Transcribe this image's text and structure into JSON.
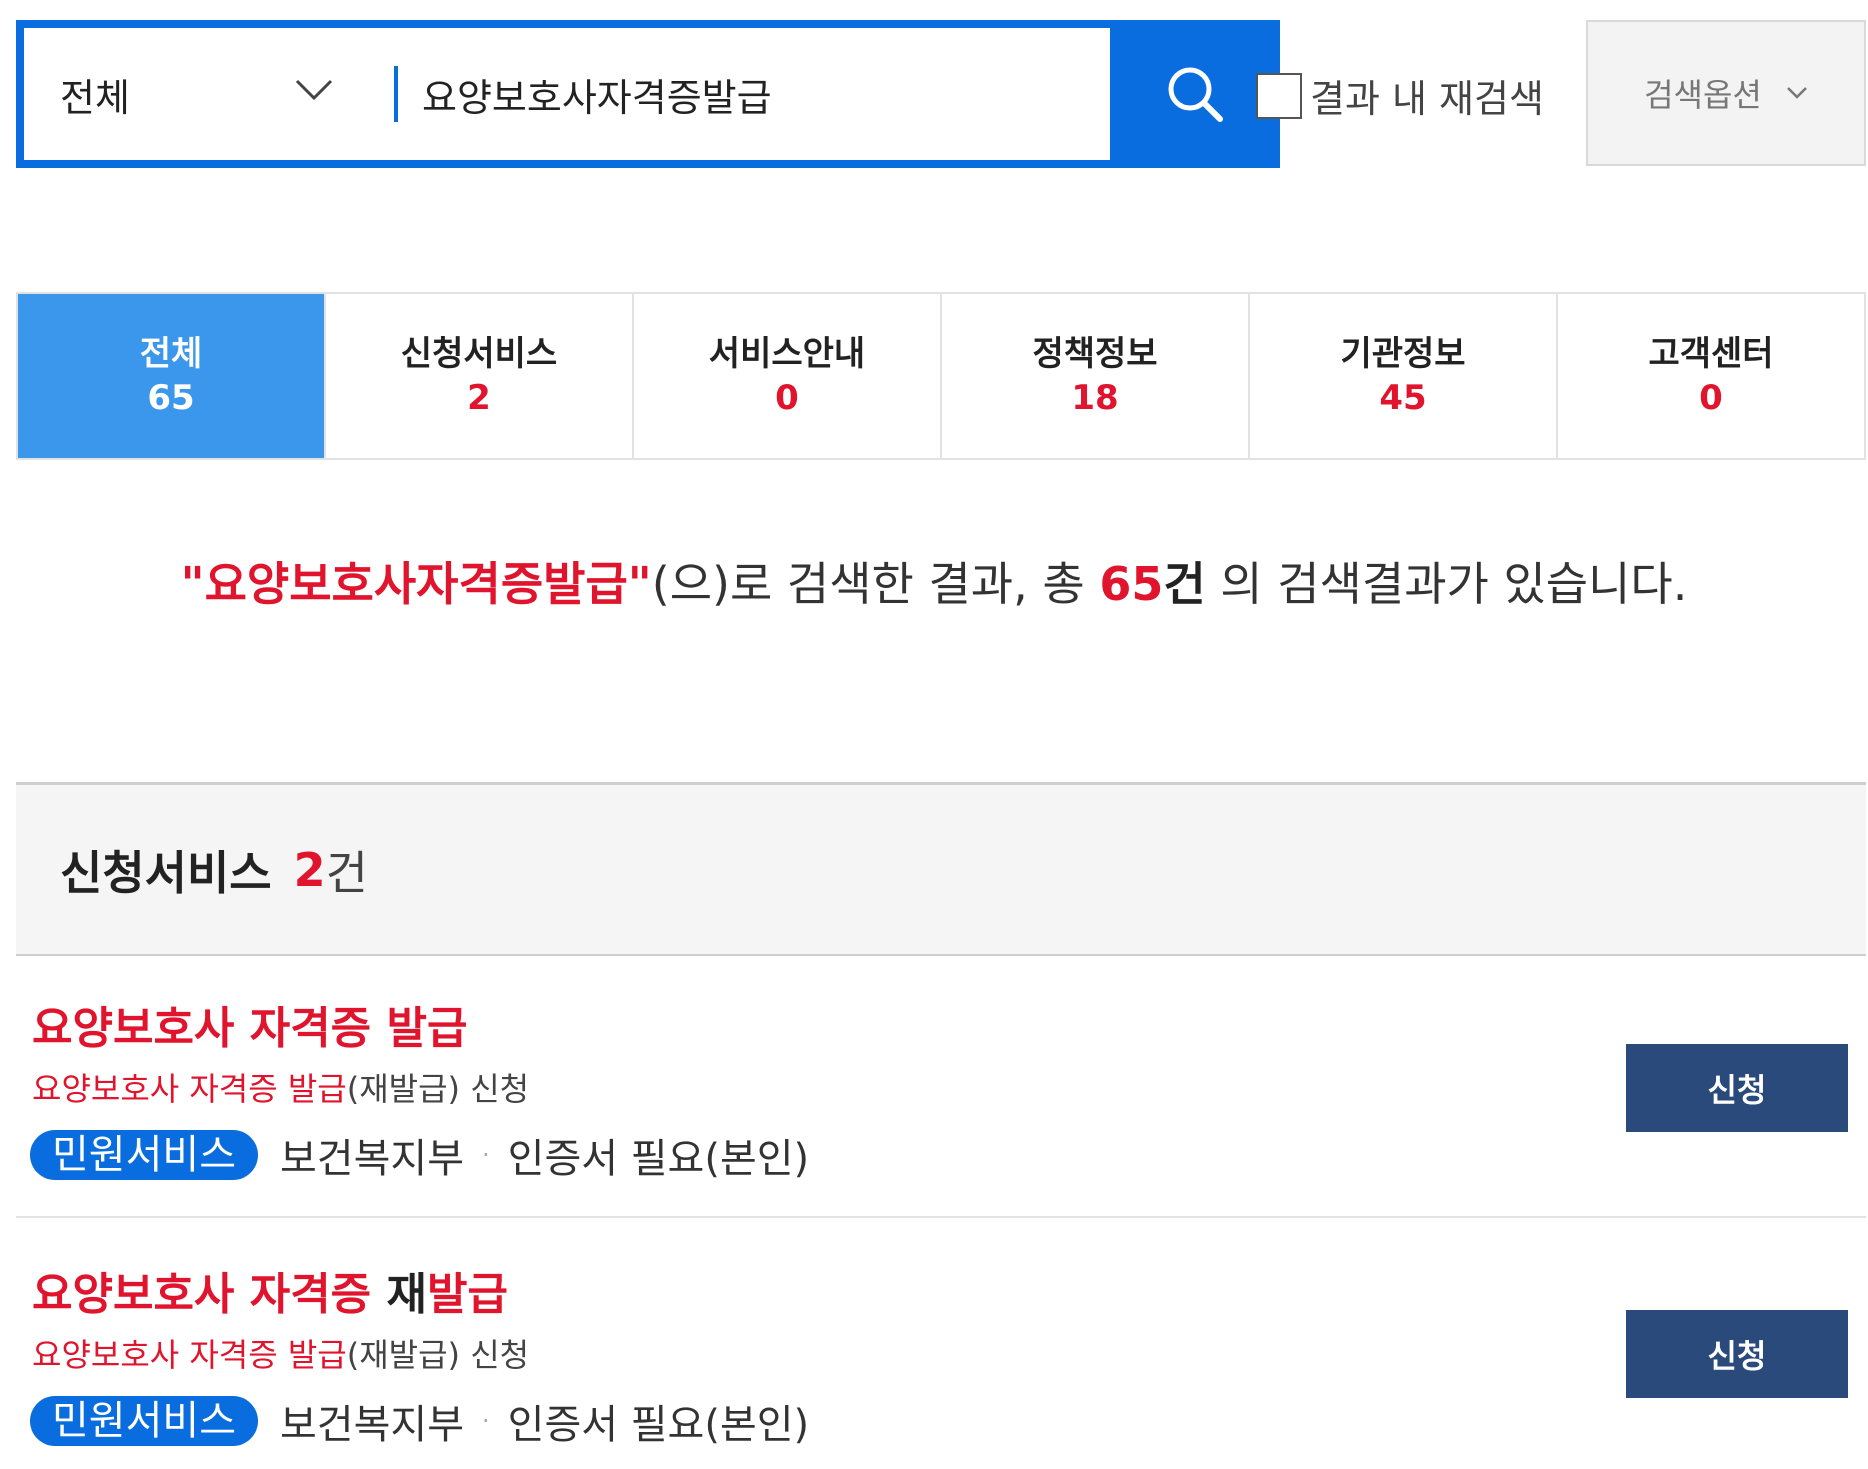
{
  "search": {
    "scope": "전체",
    "query": "요양보호사자격증발급",
    "recheck_label": "결과 내 재검색",
    "options_label": "검색옵션"
  },
  "tabs": [
    {
      "label": "전체",
      "count": "65"
    },
    {
      "label": "신청서비스",
      "count": "2"
    },
    {
      "label": "서비스안내",
      "count": "0"
    },
    {
      "label": "정책정보",
      "count": "18"
    },
    {
      "label": "기관정보",
      "count": "45"
    },
    {
      "label": "고객센터",
      "count": "0"
    }
  ],
  "summary": {
    "keyword": "\"요양보호사자격증발급\"",
    "middle": "(으)로 검색한 결과, 총 ",
    "total": "65",
    "unit": "건",
    "tail": " 의 검색결과가 있습니다."
  },
  "section": {
    "title": "신청서비스",
    "count": "2",
    "unit": "건"
  },
  "results": [
    {
      "title_hl": "요양보호사 자격증 발급",
      "title_plain": "",
      "desc_hl": "요양보호사 자격증 발급",
      "desc_plain": "(재발급) 신청",
      "badge": "민원서비스",
      "agency": "보건복지부",
      "cert": "인증서 필요(본인)",
      "button": "신청"
    },
    {
      "title_hl1": "요양보호사 자격증 ",
      "title_plain": "재",
      "title_hl2": "발급",
      "desc_hl": "요양보호사 자격증 발급",
      "desc_plain": "(재발급) 신청",
      "badge": "민원서비스",
      "agency": "보건복지부",
      "cert": "인증서 필요(본인)",
      "button": "신청"
    }
  ],
  "colors": {
    "accent_blue": "#0a6ddf",
    "active_tab": "#3b97eb",
    "highlight_red": "#e0152d",
    "apply_button": "#2a4a7c"
  }
}
